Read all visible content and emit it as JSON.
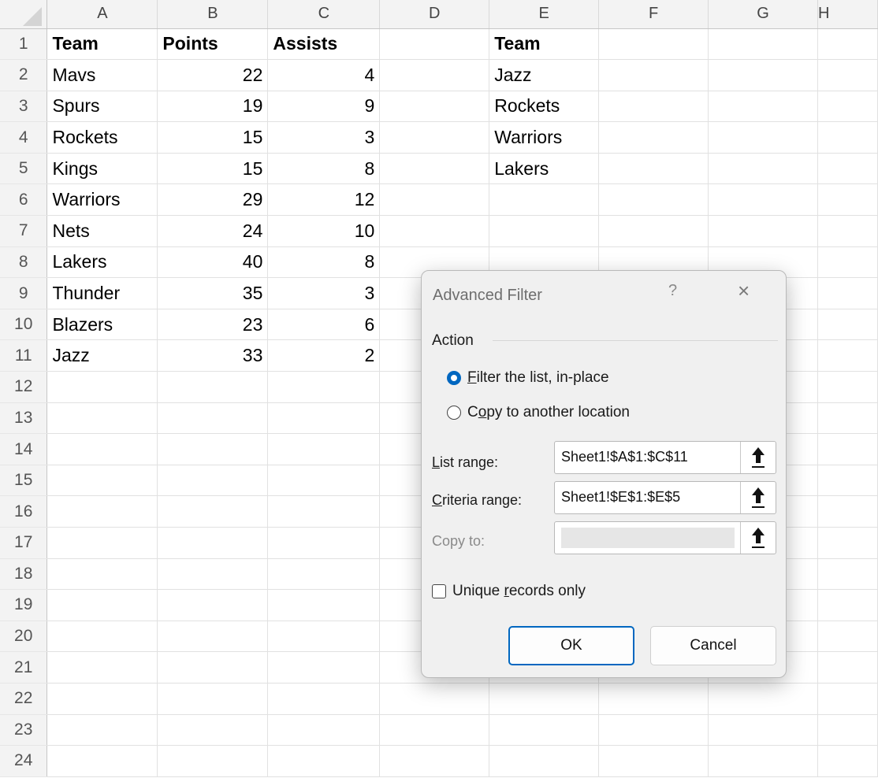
{
  "sheet": {
    "columns": [
      "A",
      "B",
      "C",
      "D",
      "E",
      "F",
      "G",
      "H"
    ],
    "rows": [
      {
        "n": "1",
        "a": "Team",
        "b": "Points",
        "c": "Assists",
        "e": "Team"
      },
      {
        "n": "2",
        "a": "Mavs",
        "b": "22",
        "c": "4",
        "e": "Jazz"
      },
      {
        "n": "3",
        "a": "Spurs",
        "b": "19",
        "c": "9",
        "e": "Rockets"
      },
      {
        "n": "4",
        "a": "Rockets",
        "b": "15",
        "c": "3",
        "e": "Warriors"
      },
      {
        "n": "5",
        "a": "Kings",
        "b": "15",
        "c": "8",
        "e": "Lakers"
      },
      {
        "n": "6",
        "a": "Warriors",
        "b": "29",
        "c": "12",
        "e": ""
      },
      {
        "n": "7",
        "a": "Nets",
        "b": "24",
        "c": "10",
        "e": ""
      },
      {
        "n": "8",
        "a": "Lakers",
        "b": "40",
        "c": "8",
        "e": ""
      },
      {
        "n": "9",
        "a": "Thunder",
        "b": "35",
        "c": "3",
        "e": ""
      },
      {
        "n": "10",
        "a": "Blazers",
        "b": "23",
        "c": "6",
        "e": ""
      },
      {
        "n": "11",
        "a": "Jazz",
        "b": "33",
        "c": "2",
        "e": ""
      },
      {
        "n": "12",
        "a": "",
        "b": "",
        "c": "",
        "e": ""
      },
      {
        "n": "13",
        "a": "",
        "b": "",
        "c": "",
        "e": ""
      },
      {
        "n": "14",
        "a": "",
        "b": "",
        "c": "",
        "e": ""
      },
      {
        "n": "15",
        "a": "",
        "b": "",
        "c": "",
        "e": ""
      },
      {
        "n": "16",
        "a": "",
        "b": "",
        "c": "",
        "e": ""
      },
      {
        "n": "17",
        "a": "",
        "b": "",
        "c": "",
        "e": ""
      },
      {
        "n": "18",
        "a": "",
        "b": "",
        "c": "",
        "e": ""
      },
      {
        "n": "19",
        "a": "",
        "b": "",
        "c": "",
        "e": ""
      },
      {
        "n": "20",
        "a": "",
        "b": "",
        "c": "",
        "e": ""
      },
      {
        "n": "21",
        "a": "",
        "b": "",
        "c": "",
        "e": ""
      },
      {
        "n": "22",
        "a": "",
        "b": "",
        "c": "",
        "e": ""
      },
      {
        "n": "23",
        "a": "",
        "b": "",
        "c": "",
        "e": ""
      },
      {
        "n": "24",
        "a": "",
        "b": "",
        "c": "",
        "e": ""
      }
    ]
  },
  "dialog": {
    "title": "Advanced Filter",
    "help": "?",
    "close": "×",
    "action_label": "Action",
    "radio_filter": {
      "accel": "F",
      "rest": "ilter the list, in-place",
      "selected": true
    },
    "radio_copy": {
      "pre": "C",
      "accel": "o",
      "rest": "py to another location",
      "selected": false
    },
    "list_range": {
      "accel": "L",
      "rest": "ist range:",
      "value": "Sheet1!$A$1:$C$11"
    },
    "criteria_range": {
      "accel": "C",
      "rest": "riteria range:",
      "value": "Sheet1!$E$1:$E$5"
    },
    "copy_to": {
      "label": "Copy to:",
      "value": ""
    },
    "unique": {
      "pre": "Unique ",
      "accel": "r",
      "rest": "ecords only",
      "checked": false
    },
    "ok_label": "OK",
    "cancel_label": "Cancel"
  },
  "colors": {
    "accent": "#0067c0",
    "header_bg": "#f3f3f3",
    "dialog_bg": "#f0f0f0"
  }
}
